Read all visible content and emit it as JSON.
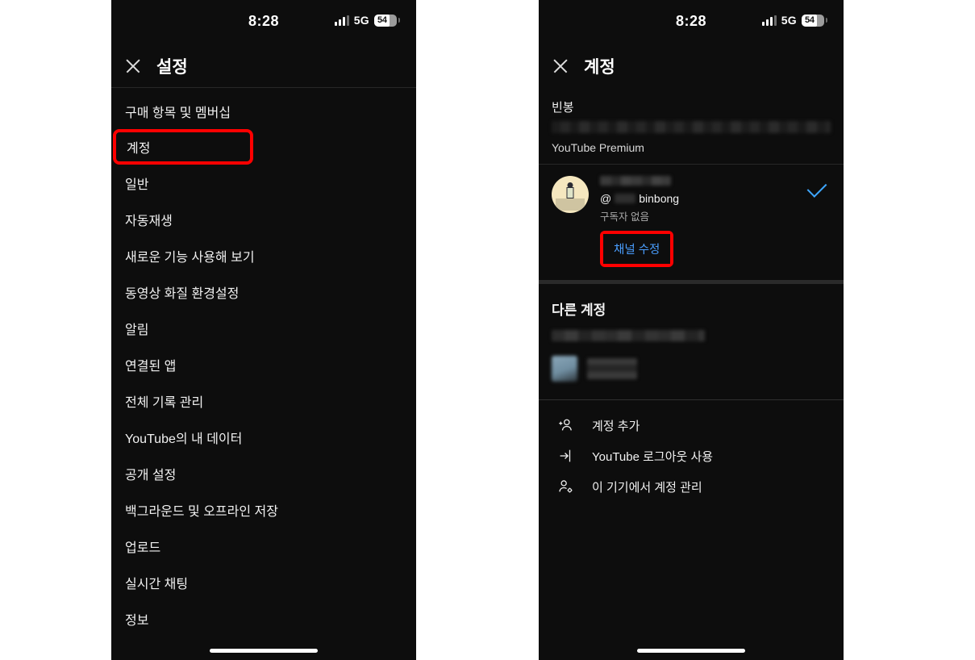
{
  "colors": {
    "background": "#ffffff",
    "panel": "#0d0d0d",
    "text_primary": "#f1f1f1",
    "text_secondary": "#aaaaaa",
    "accent_blue": "#3ea6ff",
    "highlight_red": "#ff0000"
  },
  "status_bar": {
    "time": "8:28",
    "network": "5G",
    "battery_percent": "54",
    "signal_icon": "signal-bars-icon",
    "battery_icon": "battery-icon"
  },
  "left_panel": {
    "close_icon": "close-icon",
    "title": "설정",
    "items": [
      {
        "label": "구매 항목 및 멤버십",
        "highlighted": false
      },
      {
        "label": "계정",
        "highlighted": true
      },
      {
        "label": "일반",
        "highlighted": false
      },
      {
        "label": "자동재생",
        "highlighted": false
      },
      {
        "label": "새로운 기능 사용해 보기",
        "highlighted": false
      },
      {
        "label": "동영상 화질 환경설정",
        "highlighted": false
      },
      {
        "label": "알림",
        "highlighted": false
      },
      {
        "label": "연결된 앱",
        "highlighted": false
      },
      {
        "label": "전체 기록 관리",
        "highlighted": false
      },
      {
        "label": "YouTube의 내 데이터",
        "highlighted": false
      },
      {
        "label": "공개 설정",
        "highlighted": false
      },
      {
        "label": "백그라운드 및 오프라인 저장",
        "highlighted": false
      },
      {
        "label": "업로드",
        "highlighted": false
      },
      {
        "label": "실시간 채팅",
        "highlighted": false
      },
      {
        "label": "정보",
        "highlighted": false
      }
    ]
  },
  "right_panel": {
    "close_icon": "close-icon",
    "title": "계정",
    "account": {
      "name": "빈봉",
      "email_redacted": true,
      "membership": "YouTube Premium"
    },
    "channel": {
      "avatar_icon": "avatar-illustration",
      "name_redacted": true,
      "handle_prefix": "@",
      "handle_suffix": "binbong",
      "subscribers": "구독자 없음",
      "selected_icon": "checkmark-icon",
      "edit_button": "채널 수정",
      "edit_button_highlighted": true
    },
    "other_accounts": {
      "heading": "다른 계정",
      "entries_redacted": true
    },
    "actions": [
      {
        "label": "계정 추가",
        "icon": "person-add-icon"
      },
      {
        "label": "YouTube 로그아웃 사용",
        "icon": "sign-out-icon"
      },
      {
        "label": "이 기기에서 계정 관리",
        "icon": "person-settings-icon"
      }
    ]
  }
}
